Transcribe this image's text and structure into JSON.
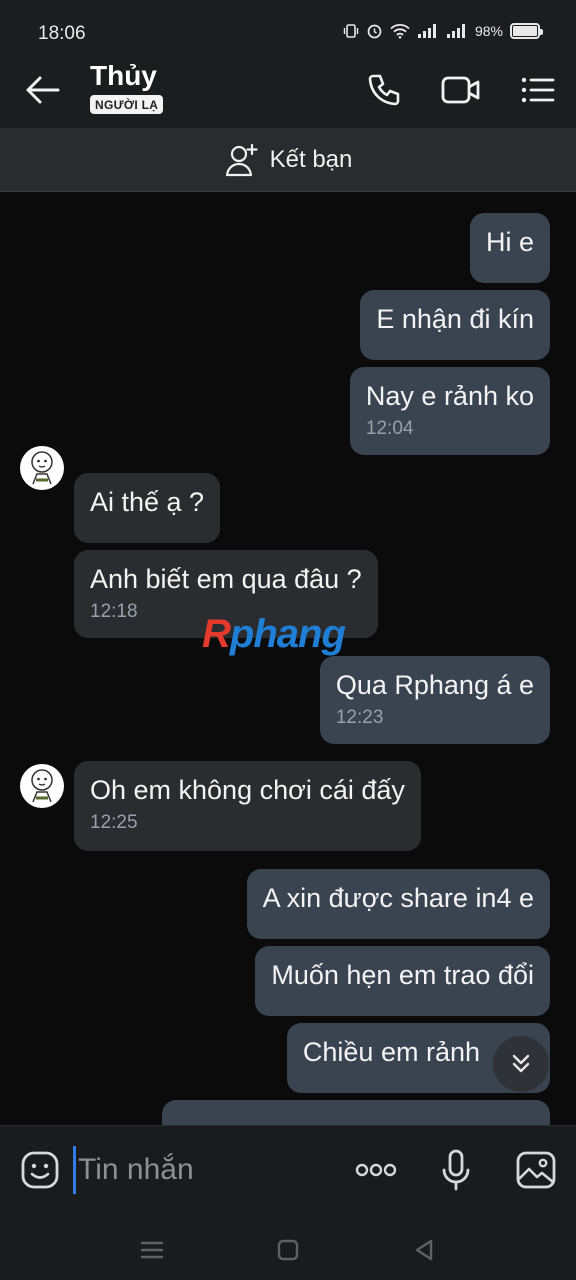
{
  "status": {
    "time": "18:06",
    "battery_text": "98%",
    "battery_level": 0.98
  },
  "header": {
    "name": "Thủy",
    "badge": "NGƯỜI LẠ"
  },
  "add_friend": {
    "label": "Kết bạn"
  },
  "messages": [
    {
      "dir": "out",
      "text": "Hi e",
      "time": ""
    },
    {
      "dir": "out",
      "text": "E nhận đi kín",
      "time": ""
    },
    {
      "dir": "out",
      "text": "Nay e rảnh ko",
      "time": "12:04"
    },
    {
      "dir": "in",
      "text": "Ai thế ạ ?",
      "time": ""
    },
    {
      "dir": "in",
      "text": "Anh biết em qua đâu ?",
      "time": "12:18"
    },
    {
      "dir": "out",
      "text": "Qua Rphang á e",
      "time": "12:23"
    },
    {
      "dir": "in",
      "text": "Oh em không chơi cái đấy",
      "time": "12:25"
    },
    {
      "dir": "out",
      "text": "A xin được share in4 e",
      "time": ""
    },
    {
      "dir": "out",
      "text": "Muốn hẹn em trao đổi",
      "time": ""
    },
    {
      "dir": "out",
      "text": "Chiều em rảnh",
      "time": ""
    },
    {
      "dir": "out",
      "text": "",
      "time": ""
    }
  ],
  "watermark": {
    "first": "R",
    "rest": "phang"
  },
  "composer": {
    "placeholder": "Tin nhắn"
  },
  "icons": {
    "back": "arrow-left-icon",
    "call": "phone-icon",
    "video": "video-icon",
    "menu": "list-menu-icon",
    "add_friend": "add-user-icon",
    "emoji": "emoji-icon",
    "more": "more-dots-icon",
    "mic": "microphone-icon",
    "gallery": "image-icon",
    "scroll": "chevron-double-down-icon"
  },
  "colors": {
    "outgoing_bubble": "#3a4350",
    "incoming_bubble": "#2b2c2f",
    "accent": "#2f7de8"
  }
}
